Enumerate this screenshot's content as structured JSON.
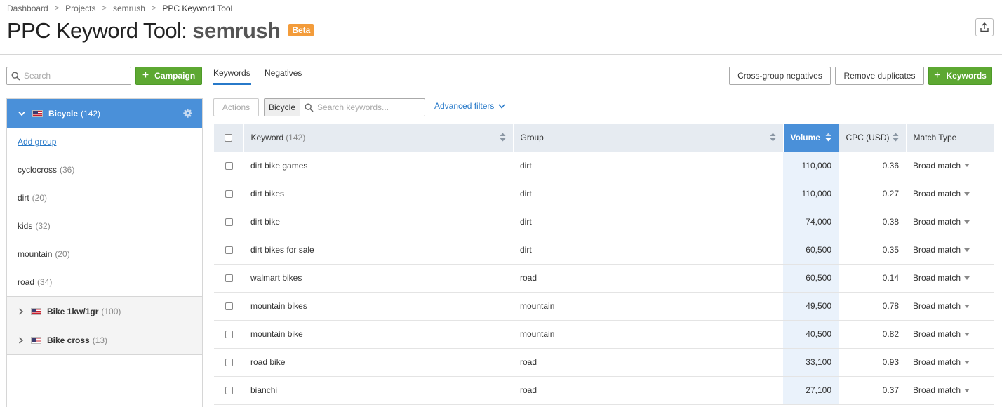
{
  "breadcrumb": [
    "Dashboard",
    "Projects",
    "semrush",
    "PPC Keyword Tool"
  ],
  "title": {
    "tool": "PPC Keyword Tool:",
    "project": "semrush",
    "badge": "Beta"
  },
  "sidebar": {
    "search_placeholder": "Search",
    "campaign_button": "Campaign",
    "active_campaign": {
      "name": "Bicycle",
      "count": "(142)"
    },
    "add_group": "Add group",
    "groups": [
      {
        "name": "cyclocross",
        "count": "(36)"
      },
      {
        "name": "dirt",
        "count": "(20)"
      },
      {
        "name": "kids",
        "count": "(32)"
      },
      {
        "name": "mountain",
        "count": "(20)"
      },
      {
        "name": "road",
        "count": "(34)"
      }
    ],
    "collapsed_campaigns": [
      {
        "name": "Bike 1kw/1gr",
        "count": "(100)"
      },
      {
        "name": "Bike cross",
        "count": "(13)"
      }
    ]
  },
  "tabs": {
    "keywords": "Keywords",
    "negatives": "Negatives"
  },
  "toolbar": {
    "cross_group": "Cross-group negatives",
    "remove_duplicates": "Remove duplicates",
    "add_keywords": "Keywords",
    "actions": "Actions",
    "scope": "Bicycle",
    "search_placeholder": "Search keywords...",
    "advanced_filters": "Advanced filters"
  },
  "table": {
    "headers": {
      "keyword": "Keyword",
      "keyword_count": "(142)",
      "group": "Group",
      "volume": "Volume",
      "cpc": "CPC (USD)",
      "match": "Match Type"
    },
    "rows": [
      {
        "keyword": "dirt bike games",
        "group": "dirt",
        "volume": "110,000",
        "cpc": "0.36",
        "match": "Broad match"
      },
      {
        "keyword": "dirt bikes",
        "group": "dirt",
        "volume": "110,000",
        "cpc": "0.27",
        "match": "Broad match"
      },
      {
        "keyword": "dirt bike",
        "group": "dirt",
        "volume": "74,000",
        "cpc": "0.38",
        "match": "Broad match"
      },
      {
        "keyword": "dirt bikes for sale",
        "group": "dirt",
        "volume": "60,500",
        "cpc": "0.35",
        "match": "Broad match"
      },
      {
        "keyword": "walmart bikes",
        "group": "road",
        "volume": "60,500",
        "cpc": "0.14",
        "match": "Broad match"
      },
      {
        "keyword": "mountain bikes",
        "group": "mountain",
        "volume": "49,500",
        "cpc": "0.78",
        "match": "Broad match"
      },
      {
        "keyword": "mountain bike",
        "group": "mountain",
        "volume": "40,500",
        "cpc": "0.82",
        "match": "Broad match"
      },
      {
        "keyword": "road bike",
        "group": "road",
        "volume": "33,100",
        "cpc": "0.93",
        "match": "Broad match"
      },
      {
        "keyword": "bianchi",
        "group": "road",
        "volume": "27,100",
        "cpc": "0.37",
        "match": "Broad match"
      }
    ]
  },
  "colors": {
    "accent": "#4a90d9",
    "green": "#5da832",
    "badge": "#f39c3b",
    "link": "#2779c9"
  }
}
